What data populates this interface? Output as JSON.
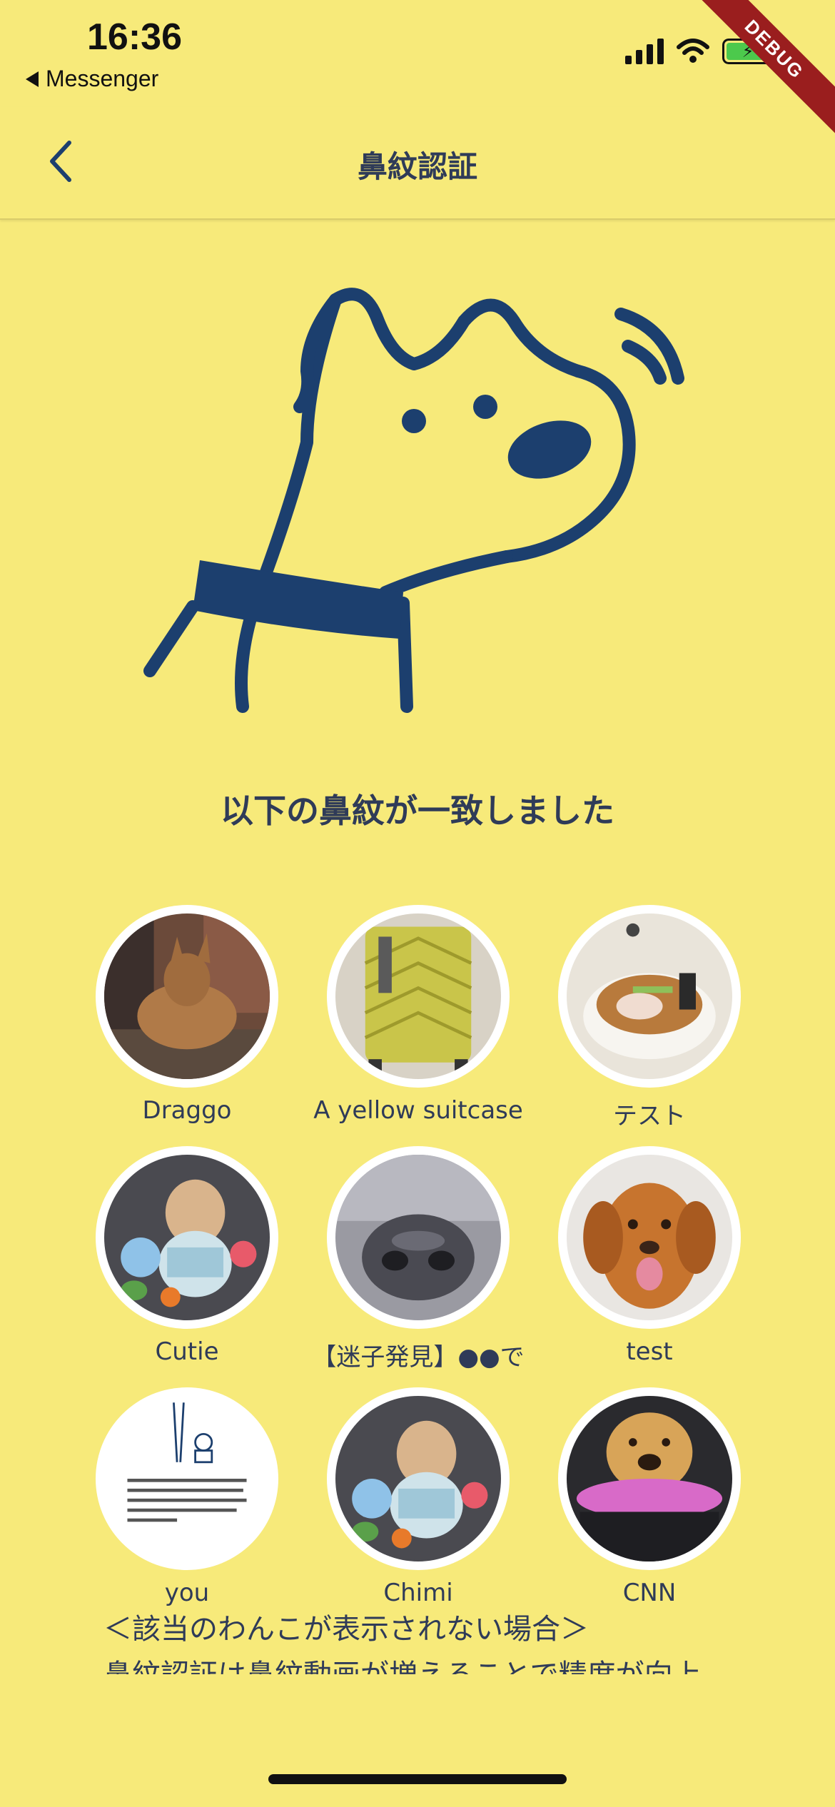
{
  "status_bar": {
    "time": "16:36",
    "back_app": "Messenger",
    "icons": [
      "signal-icon",
      "wifi-icon",
      "battery-charging-icon"
    ]
  },
  "debug_banner": "DEBUG",
  "nav": {
    "back_icon": "chevron-left-icon",
    "title": "鼻紋認証"
  },
  "hero_icon": "dog-sniffing-illustration",
  "match_title": "以下の鼻紋が一致しました",
  "matches": [
    {
      "name": "Draggo",
      "photo": "brown-dog-photo"
    },
    {
      "name": "A yellow suitcase",
      "photo": "yellow-suitcase-photo"
    },
    {
      "name": "テスト",
      "photo": "ramen-bowl-photo"
    },
    {
      "name": "Cutie",
      "photo": "poodle-with-toys-photo"
    },
    {
      "name": "【迷子発見】●●で",
      "photo": "dog-nose-closeup-photo"
    },
    {
      "name": "test",
      "photo": "golden-retriever-photo"
    },
    {
      "name": "you",
      "photo": "noseid-flyer-image"
    },
    {
      "name": "Chimi",
      "photo": "poodle-with-toys-photo"
    },
    {
      "name": "CNN",
      "photo": "puppy-in-scarf-photo"
    }
  ],
  "notice": {
    "heading": "＜該当のわんこが表示されない場合＞",
    "body": "鼻紋認証は鼻紋動画が増えることで精度が向上"
  },
  "colors": {
    "background": "#f7ea7a",
    "navy": "#1c3f6e",
    "text": "#2f3b58",
    "debug": "#9a1e1e"
  }
}
